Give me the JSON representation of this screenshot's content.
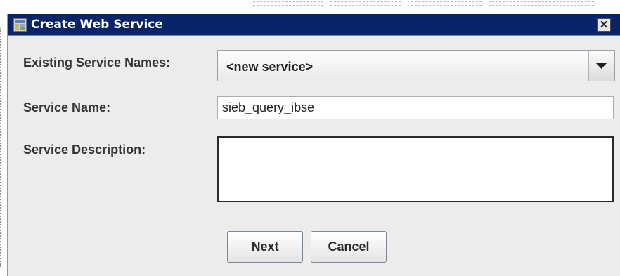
{
  "dialog": {
    "title": "Create Web Service",
    "icon": "app-window-icon",
    "close_icon": "close-icon",
    "close_label": "✕"
  },
  "form": {
    "existing_service_names_label": "Existing Service Names:",
    "existing_service_names_value": "<new service>",
    "service_name_label": "Service Name:",
    "service_name_value": "sieb_query_ibse",
    "service_description_label": "Service Description:",
    "service_description_value": ""
  },
  "buttons": {
    "next_label": "Next",
    "cancel_label": "Cancel"
  },
  "colors": {
    "titlebar": "#0a246a",
    "dialog_bg": "#ececec"
  }
}
